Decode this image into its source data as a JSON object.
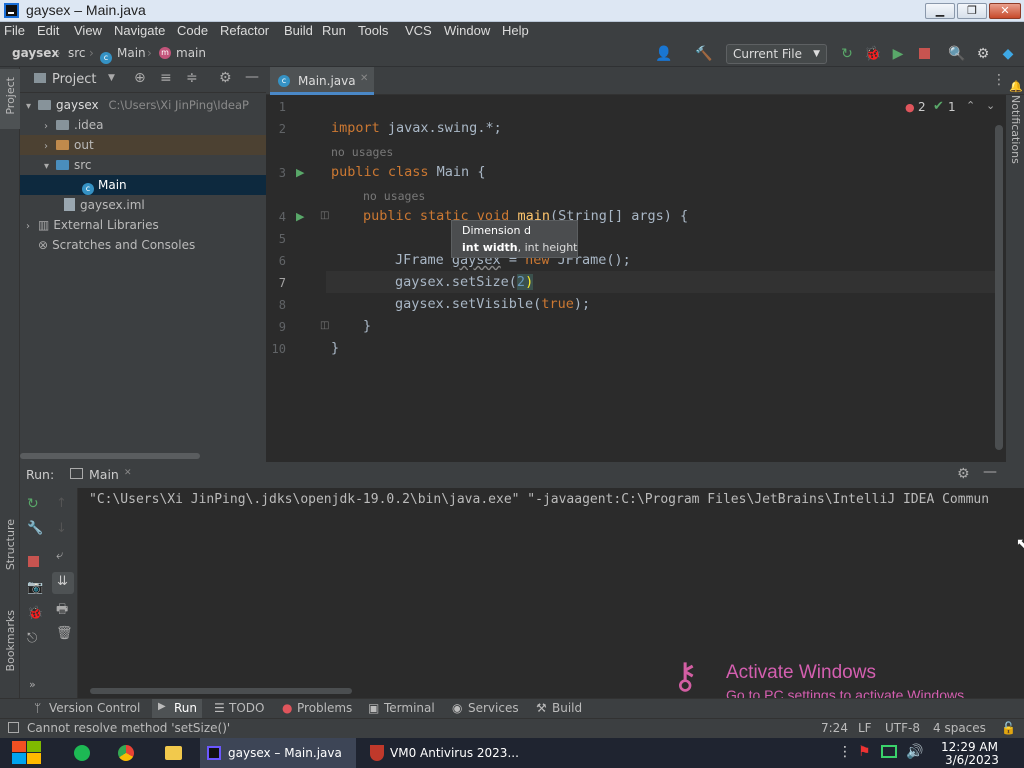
{
  "window": {
    "title": "gaysex – Main.java",
    "min": "▁",
    "max": "❐",
    "close": "✕"
  },
  "menu": [
    "File",
    "Edit",
    "View",
    "Navigate",
    "Code",
    "Refactor",
    "Build",
    "Run",
    "Tools",
    "VCS",
    "Window",
    "Help"
  ],
  "breadcrumbs": {
    "project": "gaysex",
    "src": "src",
    "cls": "Main",
    "method": "main"
  },
  "toolbar": {
    "run_config": "Current File",
    "dropdown_arrow": "▼"
  },
  "project_pane": {
    "title": "Project",
    "root": {
      "name": "gaysex",
      "path": "C:\\Users\\Xi JinPing\\IdeaP"
    },
    "items": [
      ".idea",
      "out",
      "src",
      "Main",
      "gaysex.iml",
      "External Libraries",
      "Scratches and Consoles"
    ]
  },
  "editor": {
    "tab": "Main.java",
    "inspections": {
      "errors": "2",
      "warnings": "1"
    },
    "hint_no_usages": "no usages",
    "lines": [
      "1",
      "2",
      "3",
      "4",
      "5",
      "6",
      "7",
      "8",
      "9",
      "10"
    ],
    "code": {
      "import_kw": "import",
      "import_rest": " javax.swing.*;",
      "class_kw": "public class",
      "class_rest": " Main {",
      "main_kw": "public static void",
      "main_name": "main",
      "main_rest": "(String[] args) {",
      "line6_a": "JFrame ",
      "line6_b": "gaysex",
      "line6_c": " = ",
      "line6_d": "new",
      "line6_e": " JFrame();",
      "line7_a": "gaysex.setSize(",
      "line7_b": "2",
      "line7_c": ")",
      "line8_a": "gaysex.setVisible(",
      "line8_b": "true",
      "line8_c": ");",
      "close_brace": "}"
    },
    "tooltip": {
      "line1": "Dimension d",
      "line2a": "int width",
      "line2b": ", int height"
    }
  },
  "run": {
    "label": "Run:",
    "tab": "Main",
    "output": "\"C:\\Users\\Xi JinPing\\.jdks\\openjdk-19.0.2\\bin\\java.exe\" \"-javaagent:C:\\Program Files\\JetBrains\\IntelliJ IDEA Commun"
  },
  "side_labels": {
    "project": "Project",
    "structure": "Structure",
    "bookmarks": "Bookmarks",
    "notifications": "Notifications"
  },
  "tool_tabs": [
    "Version Control",
    "Run",
    "TODO",
    "Problems",
    "Terminal",
    "Services",
    "Build"
  ],
  "status": {
    "message": "Cannot resolve method 'setSize()'",
    "position": "7:24",
    "line_sep": "LF",
    "encoding": "UTF-8",
    "indent": "4 spaces"
  },
  "watermark": {
    "line1": "Activate Windows",
    "line2": "Go to PC settings to activate Windows."
  },
  "taskbar": {
    "items": [
      "gaysex – Main.java",
      "VM0 Antivirus 2023..."
    ],
    "time": "12:29 AM",
    "date": "3/6/2023"
  }
}
